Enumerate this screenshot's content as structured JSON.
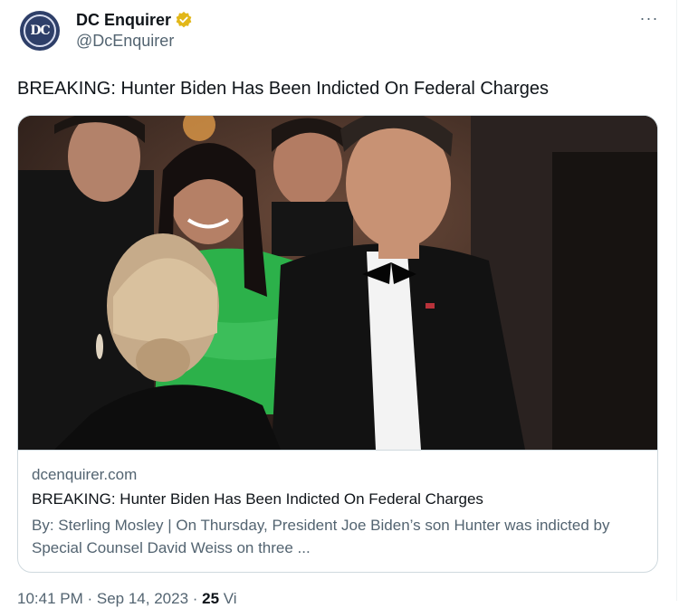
{
  "author": {
    "display_name": "DC Enquirer",
    "handle": "@DcEnquirer",
    "avatar_monogram": "DC",
    "verified_badge": "gold-verified-icon"
  },
  "tweet": {
    "text": "BREAKING: Hunter Biden Has Been Indicted On Federal Charges",
    "more_label": "···"
  },
  "card": {
    "image_icon": "photo-formal-event",
    "domain": "dcenquirer.com",
    "title": "BREAKING: Hunter Biden Has Been Indicted On Federal Charges",
    "description": "By: Sterling Mosley | On Thursday, President Joe Biden’s son Hunter was indicted by Special Counsel David Weiss on three ..."
  },
  "footer": {
    "time": "10:41 PM · Sep 14, 2023 · ",
    "views": "25",
    "views_label": " Vi"
  },
  "colors": {
    "text": "#0f1419",
    "secondary": "#536471",
    "border": "#cfd9de",
    "avatar_bg": "#2e3f69",
    "verified_gold": "#e2b719"
  }
}
